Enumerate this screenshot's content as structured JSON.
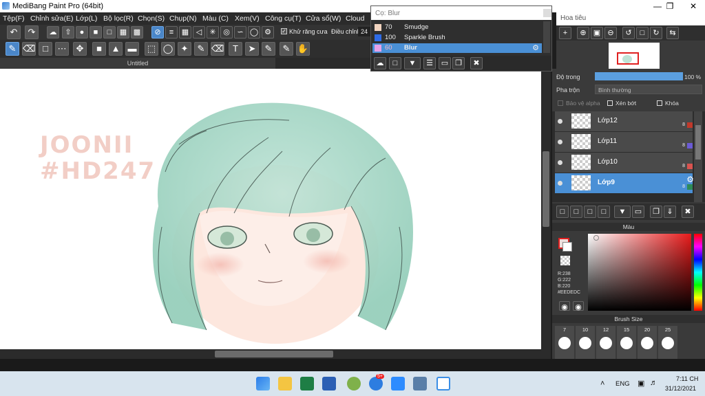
{
  "window": {
    "title": "MediBang Paint Pro (64bit)"
  },
  "menu": [
    "Tệp(F)",
    "Chỉnh sửa(E)",
    "Lớp(L)",
    "Bộ lọc(R)",
    "Chọn(S)",
    "Chụp(N)",
    "Màu (C)",
    "Xem(V)",
    "Công cụ(T)",
    "Cửa sổ(W)",
    "Cloud"
  ],
  "toolbar": {
    "antialias_label": "Khử răng cưa",
    "adjust_label": "Điều chỉnh",
    "adjust_value": "24"
  },
  "document": {
    "tab_title": "Untitled"
  },
  "canvas": {
    "watermark_line1": "JOONII",
    "watermark_line2": "#HD247"
  },
  "brush_panel": {
    "title": "Cọ: Blur",
    "brushes": [
      {
        "size": "70",
        "name": "Smudge",
        "color": "#f2d5c0"
      },
      {
        "size": "100",
        "name": "Sparkle Brush",
        "color": "#2e6be6"
      },
      {
        "size": "60",
        "name": "Blur",
        "color": "#e7a2e8",
        "selected": true
      }
    ]
  },
  "navigator": {
    "title": "Hoa tiêu"
  },
  "layers": {
    "opacity_label": "Độ trong",
    "opacity_value": "100 %",
    "blend_label": "Pha trộn",
    "blend_value": "Bình thường",
    "protect_alpha_label": "Bảo vệ alpha",
    "clip_label": "Xén bớt",
    "lock_label": "Khóa",
    "items": [
      {
        "name": "Lớp12",
        "mode": "8",
        "color": "#c0392b",
        "selected": false
      },
      {
        "name": "Lớp11",
        "mode": "8",
        "color": "#6b5bd6",
        "selected": false
      },
      {
        "name": "Lớp10",
        "mode": "8",
        "color": "#d9534f",
        "selected": false
      },
      {
        "name": "Lớp9",
        "mode": "8",
        "color": "#2e8b57",
        "selected": true
      }
    ]
  },
  "color_panel": {
    "title": "Màu",
    "r": "R:238",
    "g": "G:222",
    "b": "B:220",
    "hex": "#EEDEDC"
  },
  "brush_size_panel": {
    "title": "Brush Size",
    "sizes": [
      "7",
      "10",
      "12",
      "15",
      "20",
      "25"
    ]
  },
  "taskbar": {
    "language": "ENG",
    "time": "7:11 CH",
    "date": "31/12/2021",
    "badge": "5+"
  }
}
